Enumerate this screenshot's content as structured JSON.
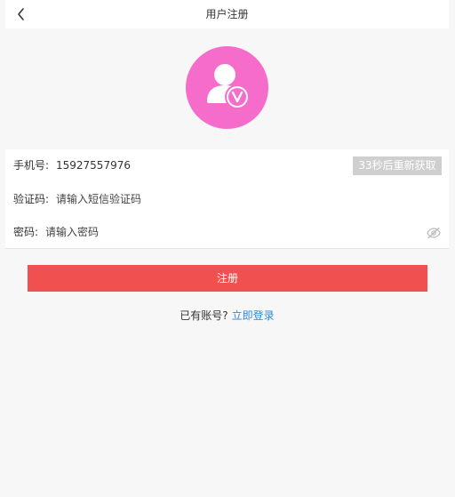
{
  "header": {
    "title": "用户注册",
    "back_icon": "chevron-left-icon"
  },
  "avatar": {
    "icon": "user-verified-icon",
    "color": "#f56ccb"
  },
  "form": {
    "phone_label": "手机号:",
    "phone_value": "15927557976",
    "sms_button_label": "33秒后重新获取",
    "code_label": "验证码:",
    "code_placeholder": "请输入短信验证码",
    "password_label": "密码:",
    "password_placeholder": "请输入密码",
    "password_toggle_icon": "eye-icon"
  },
  "actions": {
    "register_label": "注册",
    "register_color": "#f05050",
    "login_prompt": "已有账号?",
    "login_link": "立即登录",
    "link_color": "#2e8ad8"
  }
}
